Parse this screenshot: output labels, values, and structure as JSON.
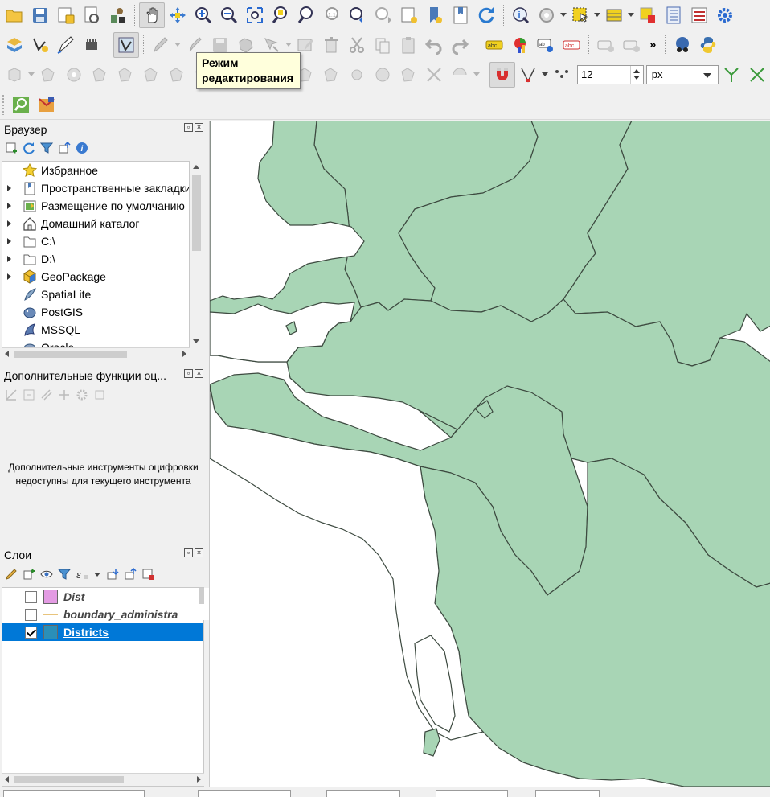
{
  "toolbar_row1": {
    "icons": [
      "folder-open-icon",
      "save-icon",
      "save-as-icon",
      "print-layout-icon",
      "layer-style-icon",
      "pan-icon",
      "pan-to-selection-icon",
      "zoom-in-icon",
      "zoom-out-icon",
      "zoom-full-icon",
      "zoom-to-selection-icon",
      "zoom-to-layer-icon",
      "zoom-native-icon",
      "zoom-last-icon",
      "zoom-next-icon",
      "new-map-view-icon",
      "bookmark-icon",
      "refresh-icon",
      "identify-icon",
      "action-icon",
      "select-features-icon",
      "open-attribute-table-icon",
      "clear-selection-icon",
      "field-calculator-icon",
      "statistics-icon",
      "settings-icon"
    ]
  },
  "toolbar_row2": {
    "icons": [
      "data-source-manager-icon",
      "new-vector-layer-icon",
      "digitize-icon",
      "toggle-editing-icon",
      "save-edits-icon",
      "add-feature-icon",
      "vertex-tool-icon",
      "delete-icon",
      "cut-icon",
      "copy-icon",
      "paste-icon",
      "undo-icon",
      "redo-icon",
      "label-icon",
      "diagram-icon",
      "pin-labels-icon",
      "show-labels-icon",
      "more-icon",
      "plugins-icon",
      "python-icon"
    ],
    "more_label": "»"
  },
  "toolbar_row3": {
    "snap_tolerance": "12",
    "snap_units": "px"
  },
  "tooltip": {
    "line1": "Режим",
    "line2": "редактирования"
  },
  "browser_panel": {
    "title": "Браузер",
    "items": [
      {
        "label": "Избранное",
        "icon": "star-icon",
        "expandable": false
      },
      {
        "label": "Пространственные закладки",
        "icon": "bookmarks-icon",
        "expandable": true
      },
      {
        "label": "Размещение по умолчанию",
        "icon": "project-home-icon",
        "expandable": true
      },
      {
        "label": "Домашний каталог",
        "icon": "home-icon",
        "expandable": true
      },
      {
        "label": "C:\\",
        "icon": "folder-icon",
        "expandable": true
      },
      {
        "label": "D:\\",
        "icon": "folder-icon",
        "expandable": true
      },
      {
        "label": "GeoPackage",
        "icon": "geopackage-icon",
        "expandable": true
      },
      {
        "label": "SpatiaLite",
        "icon": "spatialite-icon",
        "expandable": false
      },
      {
        "label": "PostGIS",
        "icon": "postgis-icon",
        "expandable": false
      },
      {
        "label": "MSSQL",
        "icon": "mssql-icon",
        "expandable": false
      },
      {
        "label": "Oracle",
        "icon": "oracle-icon",
        "expandable": false
      }
    ]
  },
  "digitizing_panel": {
    "title": "Дополнительные функции оц...",
    "message_line1": "Дополнительные инструменты оцифровки",
    "message_line2": "недоступны для текущего инструмента"
  },
  "layers_panel": {
    "title": "Слои",
    "layers": [
      {
        "name": "Dist",
        "checked": false,
        "symbol_color": "#e39be3",
        "symbol": "polygon",
        "selected": false
      },
      {
        "name": "boundary_administra",
        "checked": false,
        "symbol_color": "#e0b050",
        "symbol": "line",
        "selected": false
      },
      {
        "name": "Districts",
        "checked": true,
        "symbol_color": "#2a8fb8",
        "symbol": "polygon",
        "selected": true
      }
    ]
  },
  "map": {
    "fill_color": "#a8d5b5",
    "stroke_color": "#3d4a40"
  }
}
